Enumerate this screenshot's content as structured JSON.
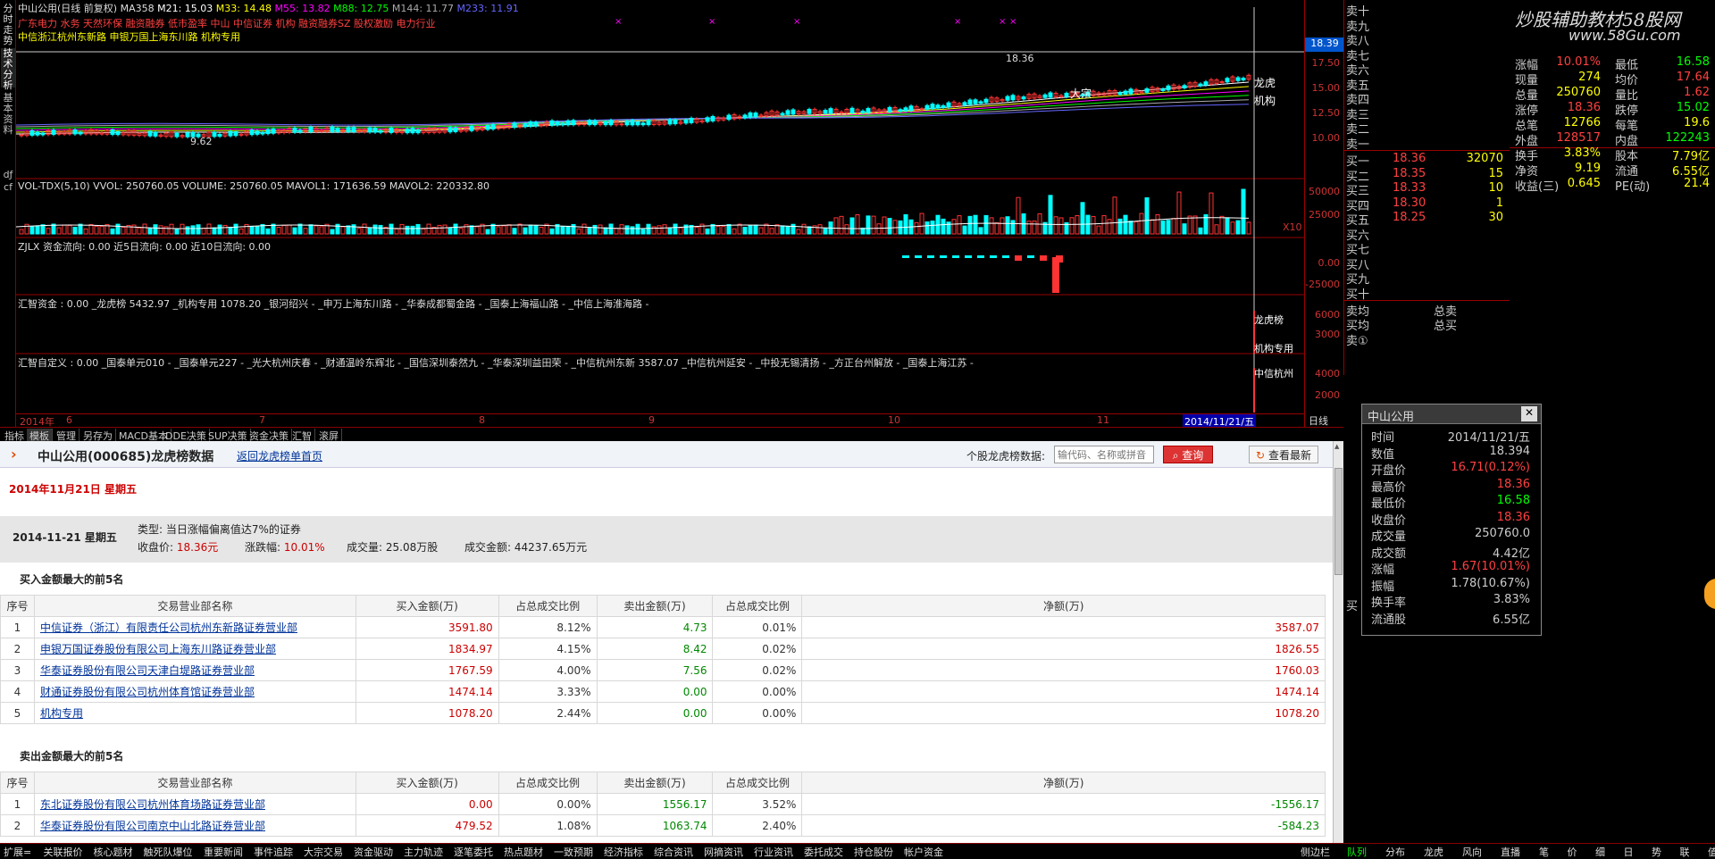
{
  "left_tabs": [
    "分时走势",
    "技术分析",
    "基本资料",
    "dƒ",
    "cf"
  ],
  "chart": {
    "title": "中山公用(日线 前复权)",
    "ma_label": "MA358",
    "ma21": "M21: 15.03",
    "ma33": "M33: 14.48",
    "ma55": "M55: 13.82",
    "ma88": "M88: 12.75",
    "ma144": "M144: 11.77",
    "ma_extra": "M233: 11.91",
    "news_line": "广东电力 水务 天然环保 融资融券 低市盈率 中山 中信证券 机构 融资融券SZ 股权激励 电力行业",
    "broker_line": "中信浙江杭州东新路 申银万国上海东川路 机构专用",
    "high_label": "18.36",
    "low_label": "9.62",
    "price_box": "18.39",
    "side_labels": [
      "大宗",
      "龙虎",
      "机构"
    ],
    "price_ticks": [
      "17.50",
      "15.00",
      "12.50",
      "10.00"
    ],
    "vol_header": "VOL-TDX(5,10)  VVOL: 250760.05  VOLUME: 250760.05  MAVOL1: 171636.59  MAVOL2: 220332.80",
    "vol_ticks": [
      "50000",
      "25000"
    ],
    "vol_mult": "X10",
    "zjlx_header": "ZJLX 资金流向: 0.00   近5日流向: 0.00   近10日流向: 0.00",
    "zjlx_ticks": [
      "0.00",
      "-25000"
    ],
    "huizhi_header": "汇智资金 : 0.00   _龙虎榜 5432.97   _机构专用 1078.20   _银河绍兴 -   _申万上海东川路 -   _华泰成都蜀金路 -   _国泰上海福山路 -   _中信上海淮海路 -",
    "huizhi_ticks": [
      "6000",
      "3000"
    ],
    "huizhi_labels": [
      "龙虎榜",
      "机构专用"
    ],
    "custom_header": "汇智自定义 : 0.00   _国泰单元010 -   _国泰单元227 -   _光大杭州庆春 -   _财通温岭东辉北 -   _国信深圳泰然九 -   _华泰深圳益田荣 -   _中信杭州东新 3587.07   _中信杭州延安 -   _中投无锡清扬 -   _方正台州解放 -   _国泰上海江苏 -",
    "custom_ticks": [
      "4000",
      "2000"
    ],
    "custom_label": "中信杭州",
    "date_axis": [
      "2014年",
      "6",
      "7",
      "8",
      "9",
      "10",
      "11"
    ],
    "date_end": "2014/11/21/五",
    "axis_mode": "日线"
  },
  "chart_toolbar": [
    "指标",
    "模板",
    "管理",
    "另存为",
    "MACD基本",
    "DDE决策",
    "SUP决策",
    "资金决策",
    "汇智",
    "滚屏"
  ],
  "order_book": {
    "sells": [
      "卖十",
      "卖九",
      "卖八",
      "卖七",
      "卖六",
      "卖五",
      "卖四",
      "卖三",
      "卖二",
      "卖一"
    ],
    "buys": [
      {
        "l": "买一",
        "p": "18.36",
        "v": "32070"
      },
      {
        "l": "买二",
        "p": "18.35",
        "v": "15"
      },
      {
        "l": "买三",
        "p": "18.33",
        "v": "10"
      },
      {
        "l": "买四",
        "p": "18.30",
        "v": "1"
      },
      {
        "l": "买五",
        "p": "18.25",
        "v": "30"
      },
      {
        "l": "买六",
        "p": "",
        "v": ""
      },
      {
        "l": "买七",
        "p": "",
        "v": ""
      },
      {
        "l": "买八",
        "p": "",
        "v": ""
      },
      {
        "l": "买九",
        "p": "",
        "v": ""
      },
      {
        "l": "买十",
        "p": "",
        "v": ""
      }
    ],
    "avg_sell": "卖均",
    "avg_buy": "买均",
    "total_sell": "总卖",
    "total_buy": "总买",
    "sell1": "卖①",
    "buy_cut": "买"
  },
  "quote": {
    "watermark": "炒股辅助教材58股网",
    "watermark_url": "www.58Gu.com",
    "rows": [
      {
        "k1": "涨幅",
        "v1": "10.01%",
        "c1": "#ff4040",
        "k2": "最低",
        "v2": "16.58",
        "c2": "#00ff00"
      },
      {
        "k1": "现量",
        "v1": "274",
        "c1": "#ffff00",
        "k2": "均价",
        "v2": "17.64",
        "c2": "#ff4040"
      },
      {
        "k1": "总量",
        "v1": "250760",
        "c1": "#ffff00",
        "k2": "量比",
        "v2": "1.62",
        "c2": "#ff4040"
      },
      {
        "k1": "涨停",
        "v1": "18.36",
        "c1": "#ff4040",
        "k2": "跌停",
        "v2": "15.02",
        "c2": "#00ff00"
      },
      {
        "k1": "总笔",
        "v1": "12766",
        "c1": "#ffff00",
        "k2": "每笔",
        "v2": "19.6",
        "c2": "#ffff00"
      },
      {
        "k1": "外盘",
        "v1": "128517",
        "c1": "#ff4040",
        "k2": "内盘",
        "v2": "122243",
        "c2": "#00ff00"
      },
      {
        "k1": "换手",
        "v1": "3.83%",
        "c1": "#ffff00",
        "k2": "股本",
        "v2": "7.79亿",
        "c2": "#ffff00"
      },
      {
        "k1": "净资",
        "v1": "9.19",
        "c1": "#ffff00",
        "k2": "流通",
        "v2": "6.55亿",
        "c2": "#ffff00"
      },
      {
        "k1": "收益(三)",
        "v1": "0.645",
        "c1": "#ffff00",
        "k2": "PE(动)",
        "v2": "21.4",
        "c2": "#ffff00"
      }
    ]
  },
  "panel": {
    "title": "中山公用(000685)龙虎榜数据",
    "back_link": "返回龙虎榜单首页",
    "search_label": "个股龙虎榜数据:",
    "search_placeholder": "输代码、名称或拼音",
    "search_btn": "查询",
    "latest_btn": "查看最新",
    "date_heading": "2014年11月21日  星期五",
    "summary_date": "2014-11-21  星期五",
    "summary_type": "类型: 当日涨幅偏离值达7%的证券",
    "close_label": "收盘价: ",
    "close_val": "18.36元",
    "chg_label": "涨跌幅: ",
    "chg_val": "10.01%",
    "vol_label": "成交量: 25.08万股",
    "amt_label": "成交金额: 44237.65万元",
    "buy_section": "买入金额最大的前5名",
    "sell_section": "卖出金额最大的前5名",
    "headers": [
      "序号",
      "交易营业部名称",
      "买入金额(万)",
      "占总成交比例",
      "卖出金额(万)",
      "占总成交比例",
      "净额(万)"
    ],
    "buy_rows": [
      [
        "1",
        "中信证券（浙江）有限责任公司杭州东新路证券营业部",
        "3591.80",
        "8.12%",
        "4.73",
        "0.01%",
        "3587.07"
      ],
      [
        "2",
        "申银万国证券股份有限公司上海东川路证券营业部",
        "1834.97",
        "4.15%",
        "8.42",
        "0.02%",
        "1826.55"
      ],
      [
        "3",
        "华泰证券股份有限公司天津白堤路证券营业部",
        "1767.59",
        "4.00%",
        "7.56",
        "0.02%",
        "1760.03"
      ],
      [
        "4",
        "财通证券股份有限公司杭州体育馆证券营业部",
        "1474.14",
        "3.33%",
        "0.00",
        "0.00%",
        "1474.14"
      ],
      [
        "5",
        "机构专用",
        "1078.20",
        "2.44%",
        "0.00",
        "0.00%",
        "1078.20"
      ]
    ],
    "sell_rows": [
      [
        "1",
        "东北证券股份有限公司杭州体育场路证券营业部",
        "0.00",
        "0.00%",
        "1556.17",
        "3.52%",
        "-1556.17"
      ],
      [
        "2",
        "华泰证券股份有限公司南京中山北路证券营业部",
        "479.52",
        "1.08%",
        "1063.74",
        "2.40%",
        "-584.23"
      ]
    ]
  },
  "popup": {
    "title": "中山公用",
    "close": "✕",
    "rows": [
      {
        "k": "时间",
        "v": "2014/11/21/五",
        "c": "#ccc"
      },
      {
        "k": "数值",
        "v": "18.394",
        "c": "#ccc"
      },
      {
        "k": "开盘价",
        "v": "16.71(0.12%)",
        "c": "#ff4040"
      },
      {
        "k": "最高价",
        "v": "18.36",
        "c": "#ff4040"
      },
      {
        "k": "最低价",
        "v": "16.58",
        "c": "#00ff00"
      },
      {
        "k": "收盘价",
        "v": "18.36",
        "c": "#ff4040"
      },
      {
        "k": "成交量",
        "v": "250760.0",
        "c": "#ccc"
      },
      {
        "k": "成交额",
        "v": "4.42亿",
        "c": "#ccc"
      },
      {
        "k": "涨幅",
        "v": "1.67(10.01%)",
        "c": "#ff4040"
      },
      {
        "k": "振幅",
        "v": "1.78(10.67%)",
        "c": "#ccc"
      },
      {
        "k": "换手率",
        "v": "3.83%",
        "c": "#ccc"
      },
      {
        "k": "流通股",
        "v": "6.55亿",
        "c": "#ccc"
      }
    ]
  },
  "status_left": [
    "扩展=",
    "关联报价",
    "核心题材",
    "触死队爆位",
    "重要新闻",
    "事件追踪",
    "大宗交易",
    "资金驱动",
    "主力轨迹",
    "逐笔委托",
    "热点题材",
    "一致预期",
    "经济指标",
    "综合资讯",
    "网摘资讯",
    "行业资讯",
    "委托成交",
    "持仓股份",
    "帐户资金"
  ],
  "status_right": [
    "侧边栏",
    "队列",
    "分布",
    "龙虎",
    "风向",
    "直播",
    "笔",
    "价",
    "细",
    "日",
    "势",
    "联",
    "值"
  ]
}
